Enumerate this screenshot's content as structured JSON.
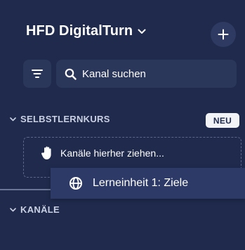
{
  "workspace": {
    "title": "HFD DigitalTurn"
  },
  "search": {
    "placeholder": "Kanal suchen"
  },
  "sections": {
    "selbstlernkurs": {
      "label": "SELBSTLERNKURS",
      "badge": "NEU",
      "dropzone_text": "Kanäle hierher ziehen..."
    },
    "kanaele": {
      "label": "KANÄLE"
    }
  },
  "dragging_item": {
    "label": "Lerneinheit 1: Ziele"
  },
  "colors": {
    "background": "#1f2a4d",
    "control_background": "#2b365b",
    "badge_background": "#f1f3f7",
    "drag_item_background": "#2d3a67"
  }
}
